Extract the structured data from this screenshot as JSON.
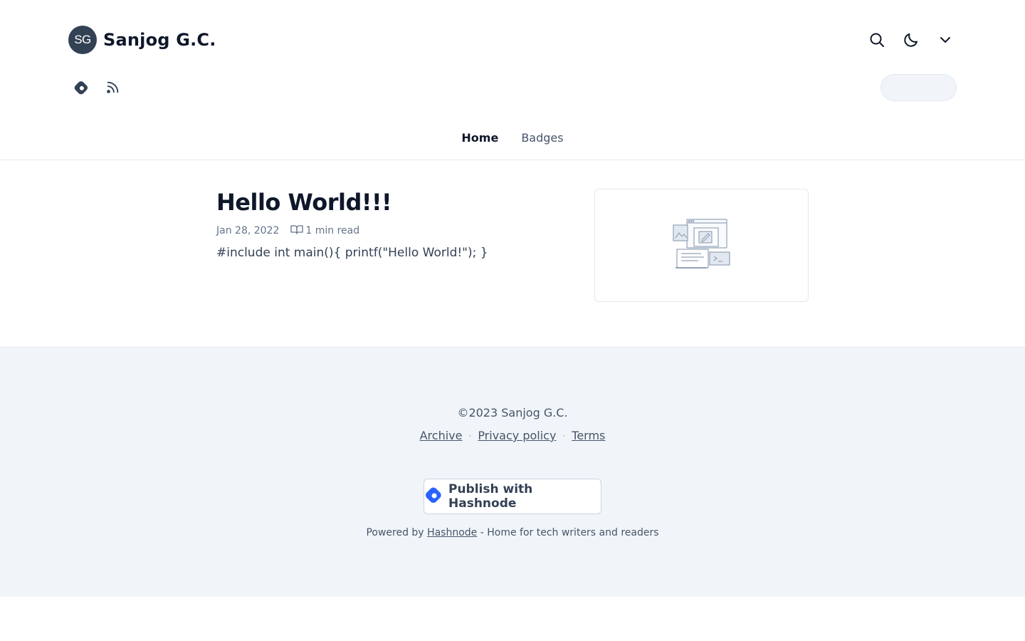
{
  "header": {
    "avatar_initials": "SG",
    "blog_title": "Sanjog G.C.",
    "actions": [
      {
        "name": "search-icon"
      },
      {
        "name": "moon-icon"
      },
      {
        "name": "chevron-down-icon"
      }
    ],
    "social": [
      {
        "name": "hashnode-icon"
      },
      {
        "name": "rss-icon"
      }
    ]
  },
  "nav": {
    "items": [
      {
        "label": "Home",
        "active": true
      },
      {
        "label": "Badges",
        "active": false
      }
    ]
  },
  "posts": [
    {
      "title": "Hello World!!!",
      "date": "Jan 28, 2022",
      "read_time": "1 min read",
      "excerpt": "#include int main(){ printf(\"Hello World!\"); }",
      "thumbnail_icon": "placeholder-illustration-icon"
    }
  ],
  "footer": {
    "copyright": "©2023 Sanjog G.C.",
    "links": [
      "Archive",
      "Privacy policy",
      "Terms"
    ],
    "separator": "·",
    "publish_label": "Publish with Hashnode",
    "powered_prefix": "Powered by",
    "powered_link": "Hashnode",
    "powered_suffix": "- Home for tech writers and readers"
  },
  "colors": {
    "text_primary": "#0f172a",
    "text_secondary": "#475569",
    "footer_bg": "#f1f5f9",
    "hashnode_blue": "#2962ff",
    "avatar_bg": "#334155"
  }
}
